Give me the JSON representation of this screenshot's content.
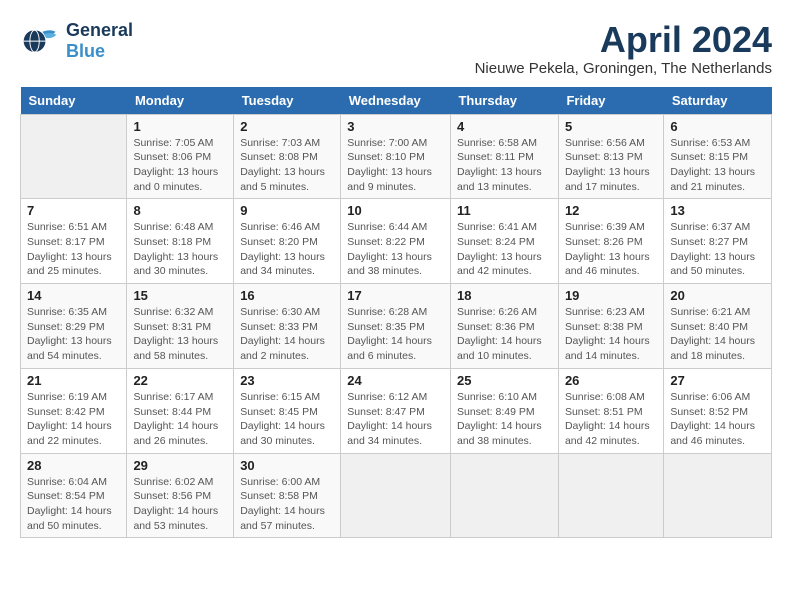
{
  "logo": {
    "line1": "General",
    "line2": "Blue"
  },
  "title": "April 2024",
  "subtitle": "Nieuwe Pekela, Groningen, The Netherlands",
  "headers": [
    "Sunday",
    "Monday",
    "Tuesday",
    "Wednesday",
    "Thursday",
    "Friday",
    "Saturday"
  ],
  "weeks": [
    [
      {
        "day": "",
        "sunrise": "",
        "sunset": "",
        "daylight": ""
      },
      {
        "day": "1",
        "sunrise": "Sunrise: 7:05 AM",
        "sunset": "Sunset: 8:06 PM",
        "daylight": "Daylight: 13 hours and 0 minutes."
      },
      {
        "day": "2",
        "sunrise": "Sunrise: 7:03 AM",
        "sunset": "Sunset: 8:08 PM",
        "daylight": "Daylight: 13 hours and 5 minutes."
      },
      {
        "day": "3",
        "sunrise": "Sunrise: 7:00 AM",
        "sunset": "Sunset: 8:10 PM",
        "daylight": "Daylight: 13 hours and 9 minutes."
      },
      {
        "day": "4",
        "sunrise": "Sunrise: 6:58 AM",
        "sunset": "Sunset: 8:11 PM",
        "daylight": "Daylight: 13 hours and 13 minutes."
      },
      {
        "day": "5",
        "sunrise": "Sunrise: 6:56 AM",
        "sunset": "Sunset: 8:13 PM",
        "daylight": "Daylight: 13 hours and 17 minutes."
      },
      {
        "day": "6",
        "sunrise": "Sunrise: 6:53 AM",
        "sunset": "Sunset: 8:15 PM",
        "daylight": "Daylight: 13 hours and 21 minutes."
      }
    ],
    [
      {
        "day": "7",
        "sunrise": "Sunrise: 6:51 AM",
        "sunset": "Sunset: 8:17 PM",
        "daylight": "Daylight: 13 hours and 25 minutes."
      },
      {
        "day": "8",
        "sunrise": "Sunrise: 6:48 AM",
        "sunset": "Sunset: 8:18 PM",
        "daylight": "Daylight: 13 hours and 30 minutes."
      },
      {
        "day": "9",
        "sunrise": "Sunrise: 6:46 AM",
        "sunset": "Sunset: 8:20 PM",
        "daylight": "Daylight: 13 hours and 34 minutes."
      },
      {
        "day": "10",
        "sunrise": "Sunrise: 6:44 AM",
        "sunset": "Sunset: 8:22 PM",
        "daylight": "Daylight: 13 hours and 38 minutes."
      },
      {
        "day": "11",
        "sunrise": "Sunrise: 6:41 AM",
        "sunset": "Sunset: 8:24 PM",
        "daylight": "Daylight: 13 hours and 42 minutes."
      },
      {
        "day": "12",
        "sunrise": "Sunrise: 6:39 AM",
        "sunset": "Sunset: 8:26 PM",
        "daylight": "Daylight: 13 hours and 46 minutes."
      },
      {
        "day": "13",
        "sunrise": "Sunrise: 6:37 AM",
        "sunset": "Sunset: 8:27 PM",
        "daylight": "Daylight: 13 hours and 50 minutes."
      }
    ],
    [
      {
        "day": "14",
        "sunrise": "Sunrise: 6:35 AM",
        "sunset": "Sunset: 8:29 PM",
        "daylight": "Daylight: 13 hours and 54 minutes."
      },
      {
        "day": "15",
        "sunrise": "Sunrise: 6:32 AM",
        "sunset": "Sunset: 8:31 PM",
        "daylight": "Daylight: 13 hours and 58 minutes."
      },
      {
        "day": "16",
        "sunrise": "Sunrise: 6:30 AM",
        "sunset": "Sunset: 8:33 PM",
        "daylight": "Daylight: 14 hours and 2 minutes."
      },
      {
        "day": "17",
        "sunrise": "Sunrise: 6:28 AM",
        "sunset": "Sunset: 8:35 PM",
        "daylight": "Daylight: 14 hours and 6 minutes."
      },
      {
        "day": "18",
        "sunrise": "Sunrise: 6:26 AM",
        "sunset": "Sunset: 8:36 PM",
        "daylight": "Daylight: 14 hours and 10 minutes."
      },
      {
        "day": "19",
        "sunrise": "Sunrise: 6:23 AM",
        "sunset": "Sunset: 8:38 PM",
        "daylight": "Daylight: 14 hours and 14 minutes."
      },
      {
        "day": "20",
        "sunrise": "Sunrise: 6:21 AM",
        "sunset": "Sunset: 8:40 PM",
        "daylight": "Daylight: 14 hours and 18 minutes."
      }
    ],
    [
      {
        "day": "21",
        "sunrise": "Sunrise: 6:19 AM",
        "sunset": "Sunset: 8:42 PM",
        "daylight": "Daylight: 14 hours and 22 minutes."
      },
      {
        "day": "22",
        "sunrise": "Sunrise: 6:17 AM",
        "sunset": "Sunset: 8:44 PM",
        "daylight": "Daylight: 14 hours and 26 minutes."
      },
      {
        "day": "23",
        "sunrise": "Sunrise: 6:15 AM",
        "sunset": "Sunset: 8:45 PM",
        "daylight": "Daylight: 14 hours and 30 minutes."
      },
      {
        "day": "24",
        "sunrise": "Sunrise: 6:12 AM",
        "sunset": "Sunset: 8:47 PM",
        "daylight": "Daylight: 14 hours and 34 minutes."
      },
      {
        "day": "25",
        "sunrise": "Sunrise: 6:10 AM",
        "sunset": "Sunset: 8:49 PM",
        "daylight": "Daylight: 14 hours and 38 minutes."
      },
      {
        "day": "26",
        "sunrise": "Sunrise: 6:08 AM",
        "sunset": "Sunset: 8:51 PM",
        "daylight": "Daylight: 14 hours and 42 minutes."
      },
      {
        "day": "27",
        "sunrise": "Sunrise: 6:06 AM",
        "sunset": "Sunset: 8:52 PM",
        "daylight": "Daylight: 14 hours and 46 minutes."
      }
    ],
    [
      {
        "day": "28",
        "sunrise": "Sunrise: 6:04 AM",
        "sunset": "Sunset: 8:54 PM",
        "daylight": "Daylight: 14 hours and 50 minutes."
      },
      {
        "day": "29",
        "sunrise": "Sunrise: 6:02 AM",
        "sunset": "Sunset: 8:56 PM",
        "daylight": "Daylight: 14 hours and 53 minutes."
      },
      {
        "day": "30",
        "sunrise": "Sunrise: 6:00 AM",
        "sunset": "Sunset: 8:58 PM",
        "daylight": "Daylight: 14 hours and 57 minutes."
      },
      {
        "day": "",
        "sunrise": "",
        "sunset": "",
        "daylight": ""
      },
      {
        "day": "",
        "sunrise": "",
        "sunset": "",
        "daylight": ""
      },
      {
        "day": "",
        "sunrise": "",
        "sunset": "",
        "daylight": ""
      },
      {
        "day": "",
        "sunrise": "",
        "sunset": "",
        "daylight": ""
      }
    ]
  ]
}
